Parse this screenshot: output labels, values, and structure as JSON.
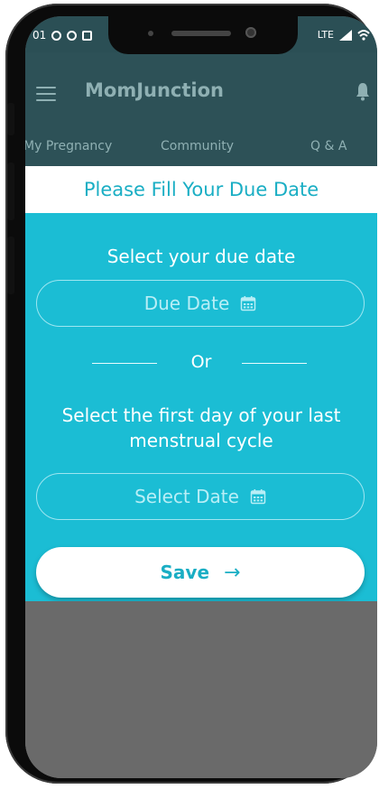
{
  "status_bar": {
    "time": "01",
    "signal_text": "LTE"
  },
  "app": {
    "title": "MomJunction",
    "tabs": [
      "My Pregnancy",
      "Community",
      "Q & A"
    ]
  },
  "modal": {
    "title": "Please Fill Your Due Date",
    "due_date_label": "Select your due date",
    "due_date_placeholder": "Due Date",
    "or_text": "Or",
    "last_cycle_label_line1": "Select the first day of your last",
    "last_cycle_label_line2": "menstrual cycle",
    "select_date_placeholder": "Select Date",
    "save_label": "Save",
    "save_arrow": "→"
  },
  "colors": {
    "accent": "#1bbdd4",
    "header": "#2d5157",
    "overlay": "#6a6a6a"
  },
  "icons": [
    "menu-icon",
    "bell-icon",
    "calendar-icon",
    "arrow-right-icon"
  ]
}
